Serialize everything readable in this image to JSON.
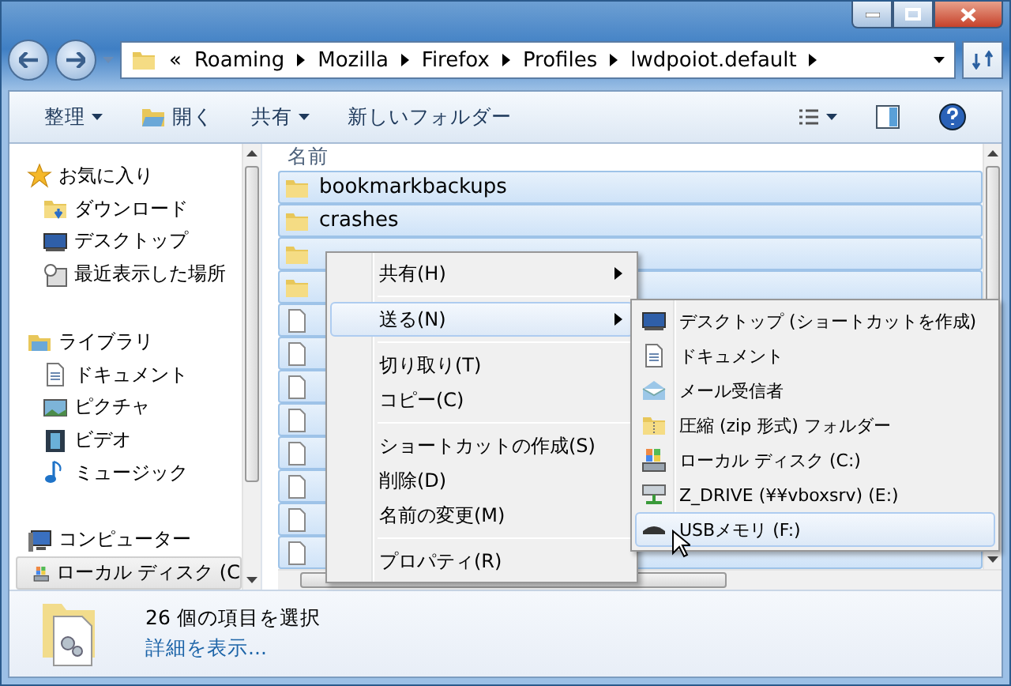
{
  "address": {
    "overflow": "«",
    "path": [
      "Roaming",
      "Mozilla",
      "Firefox",
      "Profiles",
      "lwdpoiot.default"
    ]
  },
  "toolbar": {
    "items": [
      {
        "label": "整理",
        "kind": "menu"
      },
      {
        "label": "開く",
        "kind": "open"
      },
      {
        "label": "共有",
        "kind": "menu"
      },
      {
        "label": "新しいフォルダー",
        "kind": "plain"
      }
    ]
  },
  "sidebar": {
    "groups": [
      {
        "label": "お気に入り",
        "kind": "star",
        "children": [
          {
            "label": "ダウンロード",
            "kind": "download",
            "selected": false
          },
          {
            "label": "デスクトップ",
            "kind": "desktop",
            "selected": false
          },
          {
            "label": "最近表示した場所",
            "kind": "recent",
            "selected": false
          }
        ]
      },
      {
        "label": "ライブラリ",
        "kind": "library",
        "children": [
          {
            "label": "ドキュメント",
            "kind": "document",
            "selected": false
          },
          {
            "label": "ピクチャ",
            "kind": "picture",
            "selected": false
          },
          {
            "label": "ビデオ",
            "kind": "video",
            "selected": false
          },
          {
            "label": "ミュージック",
            "kind": "music",
            "selected": false
          }
        ]
      },
      {
        "label": "コンピューター",
        "kind": "computer",
        "children": [
          {
            "label": "ローカル ディスク (C",
            "kind": "disk",
            "selected": true
          }
        ]
      }
    ]
  },
  "file_list": {
    "column": "名前",
    "rows": [
      {
        "kind": "folder",
        "name": "bookmarkbackups",
        "selected": true
      },
      {
        "kind": "folder",
        "name": "crashes",
        "selected": true
      },
      {
        "kind": "folder",
        "selected": true
      },
      {
        "kind": "folder",
        "selected": true
      },
      {
        "kind": "file",
        "selected": true
      },
      {
        "kind": "file",
        "selected": true
      },
      {
        "kind": "file",
        "selected": true
      },
      {
        "kind": "file",
        "selected": true
      },
      {
        "kind": "file",
        "selected": true
      },
      {
        "kind": "file",
        "selected": true
      },
      {
        "kind": "file",
        "selected": true
      },
      {
        "kind": "file",
        "selected": true
      }
    ]
  },
  "context_menu": {
    "groups": [
      [
        {
          "label": "共有(H)",
          "submenu": true,
          "selected": false
        }
      ],
      [
        {
          "label": "送る(N)",
          "submenu": true,
          "selected": true
        }
      ],
      [
        {
          "label": "切り取り(T)",
          "submenu": false,
          "selected": false
        },
        {
          "label": "コピー(C)",
          "submenu": false,
          "selected": false
        }
      ],
      [
        {
          "label": "ショートカットの作成(S)",
          "submenu": false,
          "selected": false
        },
        {
          "label": "削除(D)",
          "submenu": false,
          "selected": false
        },
        {
          "label": "名前の変更(M)",
          "submenu": false,
          "selected": false
        }
      ],
      [
        {
          "label": "プロパティ(R)",
          "submenu": false,
          "selected": false
        }
      ]
    ]
  },
  "send_to_menu": {
    "items": [
      {
        "label": "デスクトップ (ショートカットを作成)",
        "kind": "desktop",
        "selected": false
      },
      {
        "label": "ドキュメント",
        "kind": "document",
        "selected": false
      },
      {
        "label": "メール受信者",
        "kind": "mail",
        "selected": false
      },
      {
        "label": "圧縮 (zip 形式) フォルダー",
        "kind": "zip",
        "selected": false
      },
      {
        "label": "ローカル ディスク (C:)",
        "kind": "disk",
        "selected": false
      },
      {
        "label": "Z_DRIVE (¥¥vboxsrv) (E:)",
        "kind": "network",
        "selected": false
      },
      {
        "label": "USBメモリ (F:)",
        "kind": "usb",
        "selected": true
      }
    ]
  },
  "details": {
    "summary": "26 個の項目を選択",
    "link": "詳細を表示..."
  }
}
